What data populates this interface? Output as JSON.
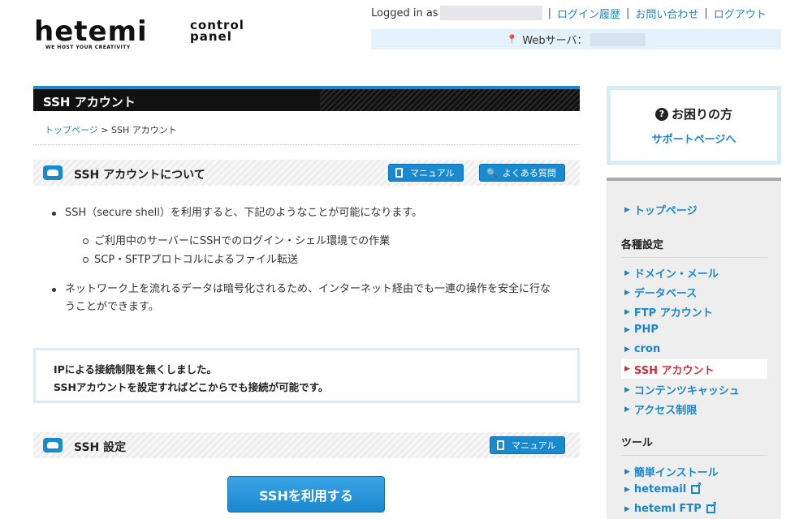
{
  "logo": {
    "text": "hetemi",
    "tagline": "WE HOST YOUR CREATIVITY",
    "panel_line1": "control",
    "panel_line2": "panel"
  },
  "header": {
    "logged_in_label": "Logged in as",
    "links": [
      "ログイン履歴",
      "お問い合わせ",
      "ログアウト"
    ],
    "separator": "|",
    "server_label": "Webサーバ："
  },
  "page": {
    "title": "SSH アカウント"
  },
  "breadcrumb": {
    "home": "トップページ",
    "sep": ">",
    "current": "SSH アカウント"
  },
  "section_about": {
    "title": "SSH アカウントについて",
    "manual_label": "マニュアル",
    "faq_label": "よくある質問",
    "bullet1": "SSH（secure shell）を利用すると、下記のようなことが可能になります。",
    "sub_items": [
      "ご利用中のサーバーにSSHでのログイン・シェル環境での作業",
      "SCP・SFTPプロトコルによるファイル転送"
    ],
    "bullet2_line1": "ネットワーク上を流れるデータは暗号化されるため、インターネット経由でも一連の操作を安全に行な",
    "bullet2_line2": "うことができます。"
  },
  "notice": {
    "line1": "IPによる接続制限を無くしました。",
    "line2": "SSHアカウントを設定すればどこからでも接続が可能です。"
  },
  "section_settings": {
    "title": "SSH 設定",
    "manual_label": "マニュアル"
  },
  "enable_button": "SSHを利用する",
  "help_box": {
    "title": "お困りの方",
    "link": "サポートページへ"
  },
  "sidenav": {
    "top": "トップページ",
    "settings_head": "各種設定",
    "settings": [
      "ドメイン・メール",
      "データベース",
      "FTP アカウント",
      "PHP",
      "cron",
      "SSH アカウント",
      "コンテンツキャッシュ",
      "アクセス制限"
    ],
    "tools_head": "ツール",
    "tools": [
      "簡単インストール",
      "hetemail",
      "heteml FTP"
    ],
    "active": "SSH アカウント",
    "colors": {
      "link": "#1b87c9",
      "active": "#d0303d"
    }
  }
}
